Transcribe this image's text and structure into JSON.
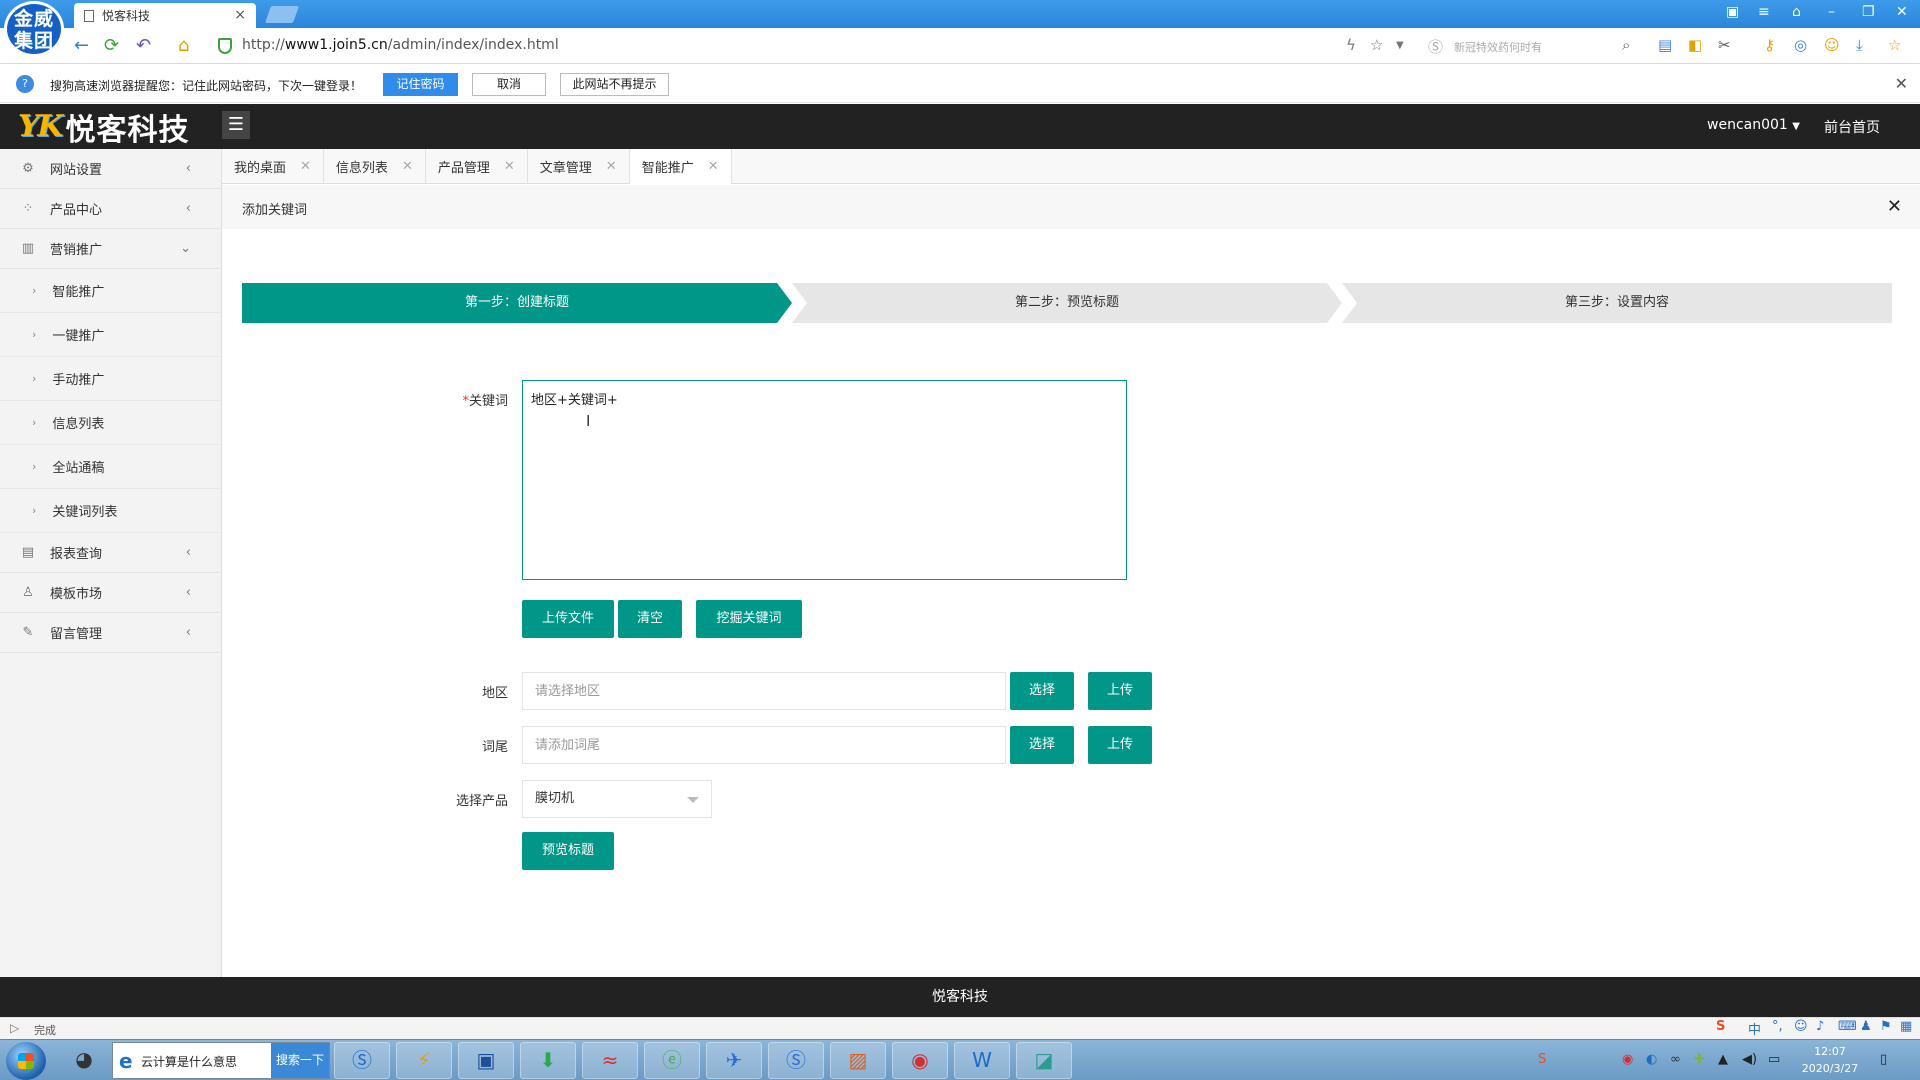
{
  "browser": {
    "badge": "金威\n集团",
    "tab_title": "悦客科技",
    "url_prefix": "http://",
    "url_host": "www1.join5.cn",
    "url_path": "/admin/index/index.html",
    "search_placeholder": "新冠特效药何时有"
  },
  "notification": {
    "text": "搜狗高速浏览器提醒您：记住此网站密码，下次一键登录！",
    "remember": "记住密码",
    "cancel": "取消",
    "never": "此网站不再提示"
  },
  "header": {
    "logo_mark": "YK",
    "logo_text": "悦客科技",
    "username": "wencan001",
    "home_link": "前台首页"
  },
  "sidebar": {
    "items": [
      {
        "label": "网站设置",
        "icon": "gear-icon"
      },
      {
        "label": "产品中心",
        "icon": "grid-icon"
      },
      {
        "label": "营销推广",
        "icon": "chart-icon"
      }
    ],
    "sub_items": [
      "智能推广",
      "一键推广",
      "手动推广",
      "信息列表",
      "全站通稿",
      "关键词列表"
    ],
    "items_after": [
      {
        "label": "报表查询",
        "icon": "report-icon"
      },
      {
        "label": "模板市场",
        "icon": "shirt-icon"
      },
      {
        "label": "留言管理",
        "icon": "pencil-icon"
      }
    ]
  },
  "tabs": [
    "我的桌面",
    "信息列表",
    "产品管理",
    "文章管理",
    "智能推广"
  ],
  "page": {
    "subtitle": "添加关键词",
    "steps": [
      "第一步：创建标题",
      "第二步：预览标题",
      "第三步：设置内容"
    ],
    "keyword_label": "关键词",
    "keyword_value": "地区+关键词+",
    "btn_upload_file": "上传文件",
    "btn_clear": "清空",
    "btn_mine": "挖掘关键词",
    "region_label": "地区",
    "region_placeholder": "请选择地区",
    "suffix_label": "词尾",
    "suffix_placeholder": "请添加词尾",
    "btn_select": "选择",
    "btn_upload": "上传",
    "product_label": "选择产品",
    "product_value": "膜切机",
    "btn_preview": "预览标题"
  },
  "footer": "悦客科技",
  "status": "完成",
  "taskbar": {
    "search_query": "云计算是什么意思",
    "search_button": "搜索一下",
    "time": "12:07",
    "date": "2020/3/27"
  },
  "colors": {
    "accent": "#009688",
    "header_bg": "#222222",
    "browser_blue": "#2a86db"
  }
}
